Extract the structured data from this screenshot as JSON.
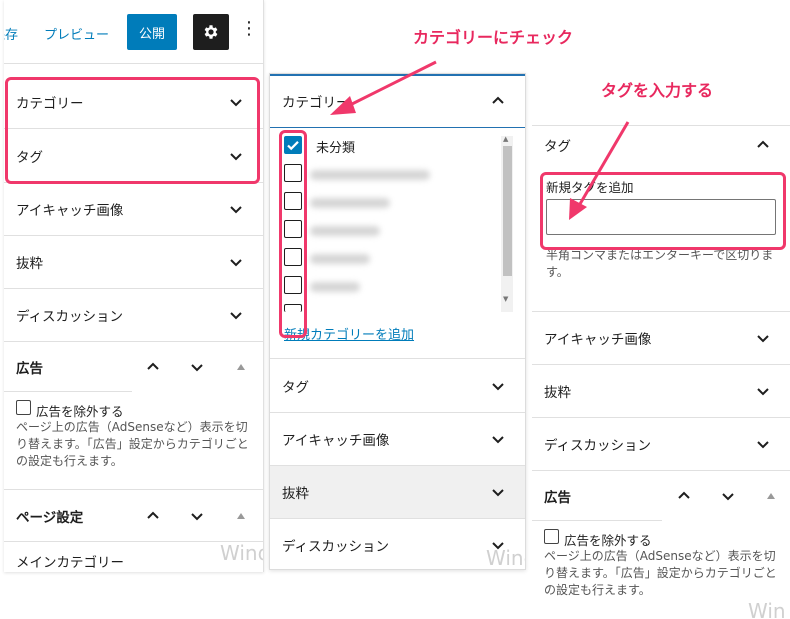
{
  "toolbar": {
    "save_label": "保存",
    "preview_label": "プレビュー",
    "publish_label": "公開"
  },
  "left_panel": {
    "category_label": "カテゴリー",
    "tag_label": "タグ",
    "featured_image_label": "アイキャッチ画像",
    "excerpt_label": "抜粋",
    "discussion_label": "ディスカッション",
    "ad_header": "広告",
    "ad_checkbox_label": "広告を除外する",
    "ad_description": "ページ上の広告（AdSenseなど）表示を切り替えます。「広告」設定からカテゴリごとの設定も行えます。",
    "page_settings_header": "ページ設定",
    "main_category_label": "メインカテゴリー",
    "watermark": "Wind"
  },
  "middle_panel": {
    "category_label": "カテゴリー",
    "uncategorized_label": "未分類",
    "add_category_link": "新規カテゴリーを追加",
    "tag_label": "タグ",
    "featured_image_label": "アイキャッチ画像",
    "excerpt_label": "抜粋",
    "discussion_label": "ディスカッション",
    "watermark": "Wind"
  },
  "right_panel": {
    "tag_label": "タグ",
    "add_tag_label": "新規タグを追加",
    "tag_input_value": "",
    "tag_help": "半角コンマまたはエンターキーで区切ります。",
    "featured_image_label": "アイキャッチ画像",
    "excerpt_label": "抜粋",
    "discussion_label": "ディスカッション",
    "ad_header": "広告",
    "ad_checkbox_label": "広告を除外する",
    "ad_description": "ページ上の広告（AdSenseなど）表示を切り替えます。「広告」設定からカテゴリごとの設定も行えます。",
    "watermark": "Win"
  },
  "annotations": {
    "category_check": "カテゴリーにチェック",
    "tag_input": "タグを入力する",
    "color": "#f0386b"
  },
  "colors": {
    "accent": "#007cba",
    "dark": "#1e1e1e"
  }
}
